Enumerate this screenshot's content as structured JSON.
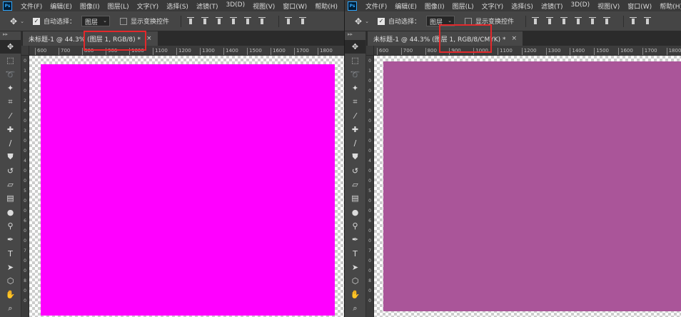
{
  "menu": [
    "文件(F)",
    "编辑(E)",
    "图像(I)",
    "图层(L)",
    "文字(Y)",
    "选择(S)",
    "滤镜(T)",
    "3D(D)",
    "视图(V)",
    "窗口(W)",
    "帮助(H)"
  ],
  "app_logo": "Ps",
  "options": {
    "auto_select_label": "自动选择：",
    "auto_select_checked": true,
    "auto_select_target": "图层",
    "show_transform_label": "显示变换控件",
    "show_transform_checked": false
  },
  "tools": [
    "move-icon",
    "marquee-icon",
    "lasso-icon",
    "magic-wand-icon",
    "crop-icon",
    "eyedropper-icon",
    "healing-icon",
    "brush-icon",
    "stamp-icon",
    "history-brush-icon",
    "eraser-icon",
    "gradient-icon",
    "blur-icon",
    "dodge-icon",
    "pen-icon",
    "type-icon",
    "path-select-icon",
    "shape-icon",
    "hand-icon",
    "zoom-icon"
  ],
  "left": {
    "tab_title": "未标题-1 @ 44.3% (图层 1, RGB/8) *",
    "ruler_ticks": [
      "600",
      "700",
      "800",
      "900",
      "1000",
      "1100",
      "1200",
      "1300",
      "1400",
      "1500",
      "1600",
      "1700",
      "1800"
    ],
    "ruler_v": [
      "0",
      "1",
      "0",
      "0",
      "2",
      "0",
      "0",
      "3",
      "0",
      "0",
      "4",
      "0",
      "0",
      "5",
      "0",
      "0",
      "6",
      "0",
      "0",
      "7",
      "0",
      "0",
      "8",
      "0",
      "0"
    ],
    "canvas_color": "#ff00ff",
    "mode_highlight": "图层 1, RGB/8)"
  },
  "right": {
    "tab_title": "未标题-1 @ 44.3% (图层 1, RGB/8/CMYK) *",
    "ruler_ticks": [
      "600",
      "700",
      "800",
      "900",
      "1000",
      "1100",
      "1200",
      "1300",
      "1400",
      "1500",
      "1600",
      "1700",
      "1800"
    ],
    "ruler_v": [
      "0",
      "1",
      "0",
      "0",
      "2",
      "0",
      "0",
      "3",
      "0",
      "0",
      "4",
      "0",
      "0",
      "5",
      "0",
      "0",
      "6",
      "0",
      "0",
      "7",
      "0",
      "0",
      "8",
      "0",
      "0"
    ],
    "canvas_color": "#aa5599",
    "mode_highlight": "图层 1, RGB/8/CMYK)"
  },
  "colors": {
    "highlight_box": "#e3282b",
    "ui_dark": "#282828",
    "ui_panel": "#474747"
  }
}
